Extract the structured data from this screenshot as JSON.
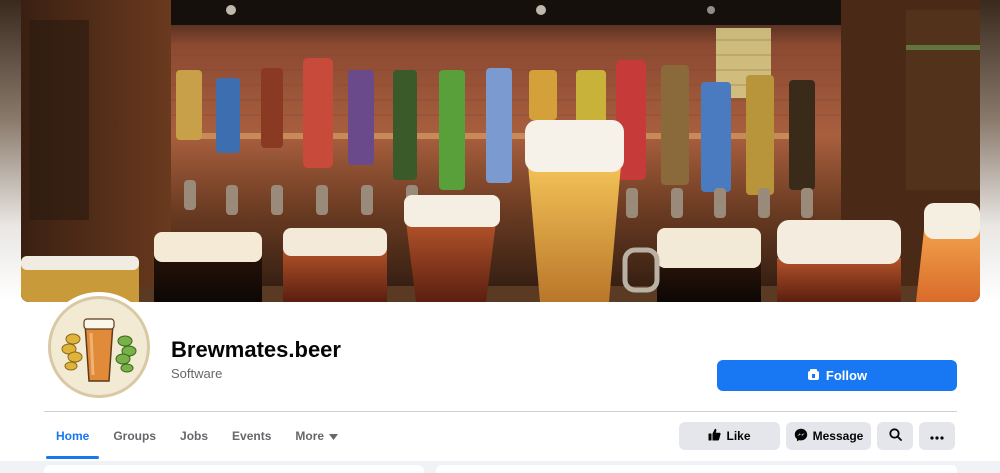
{
  "page": {
    "name": "Brewmates.beer",
    "category": "Software"
  },
  "actions": {
    "follow_label": "Follow",
    "like_label": "Like",
    "message_label": "Message"
  },
  "tabs": [
    {
      "label": "Home",
      "active": true
    },
    {
      "label": "Groups",
      "active": false
    },
    {
      "label": "Jobs",
      "active": false
    },
    {
      "label": "Events",
      "active": false
    },
    {
      "label": "More",
      "active": false
    }
  ],
  "colors": {
    "accent": "#1877f2",
    "button_gray": "#e4e6eb",
    "text_secondary": "#65676b"
  },
  "icons": {
    "follow": "follow-page-icon",
    "like": "thumbs-up-icon",
    "message": "messenger-icon",
    "search": "search-icon",
    "more": "ellipsis-icon",
    "more_tab": "caret-down-icon"
  }
}
